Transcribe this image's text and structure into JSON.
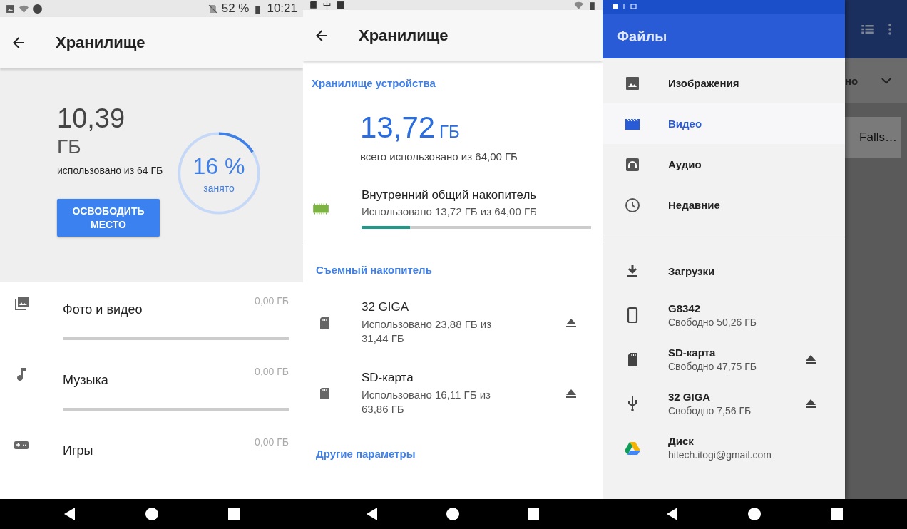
{
  "left": {
    "status_bar": {
      "battery": "52 %",
      "time": "10:21"
    },
    "title": "Хранилище",
    "used": "10,39",
    "unit": "ГБ",
    "used_caption": "использовано из 64 ГБ",
    "percent": "16 %",
    "percent_caption": "занято",
    "level": 0.16,
    "button": "ОСВОБОДИТЬ МЕСТО",
    "categories": [
      {
        "kind": "photo",
        "name": "Фото и видео",
        "size": "0,00 ГБ",
        "bar": true
      },
      {
        "kind": "music",
        "name": "Музыка",
        "size": "0,00 ГБ",
        "bar": true
      },
      {
        "kind": "games",
        "name": "Игры",
        "size": "0,00 ГБ"
      }
    ]
  },
  "middle": {
    "title": "Хранилище",
    "section": "Хранилище устройства",
    "total": "13,72",
    "unit": "ГБ",
    "total_caption": "всего использовано из 64,00 ГБ",
    "internal": {
      "name": "Внутренний общий накопитель",
      "detail": "Использовано 13,72 ГБ из 64,00 ГБ",
      "level": 0.21
    },
    "removable_header": "Съемный накопитель",
    "removable": [
      {
        "name": "32 GIGA",
        "detail": "Использовано 23,88 ГБ из 31,44 ГБ",
        "eject": true
      },
      {
        "name": "SD-карта",
        "detail": "Использовано 16,11 ГБ из 63,86 ГБ",
        "eject": true
      }
    ],
    "other": "Другие параметры"
  },
  "right": {
    "drawer_title": "Файлы",
    "categories": [
      {
        "kind": "image",
        "label": "Изображения",
        "selected": false
      },
      {
        "kind": "video",
        "label": "Видео",
        "selected": true
      },
      {
        "kind": "audio",
        "label": "Аудио",
        "selected": false
      },
      {
        "kind": "recent",
        "label": "Недавние",
        "selected": false
      }
    ],
    "locations": [
      {
        "kind": "download",
        "label": "Загрузки",
        "eject": false
      },
      {
        "kind": "phone",
        "label": "G8342",
        "detail": "Свободно 50,26 ГБ",
        "eject": false
      },
      {
        "kind": "sd",
        "label": "SD-карта",
        "detail": "Свободно 47,75 ГБ",
        "eject": true
      },
      {
        "kind": "usb",
        "label": "32 GIGA",
        "detail": "Свободно 7,56 ГБ",
        "eject": true
      },
      {
        "kind": "drive",
        "label": "Диск",
        "detail": "hitech.itogi@gmail.com",
        "eject": false
      }
    ],
    "behind": {
      "sort_label": "но",
      "file_name": "Falls…"
    }
  }
}
